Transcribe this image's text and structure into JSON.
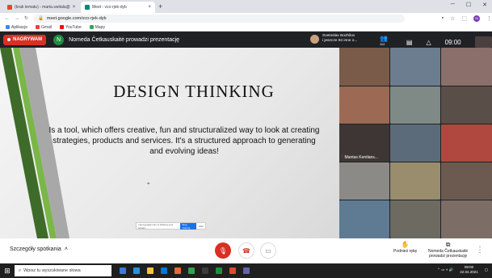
{
  "browser": {
    "tabs": [
      {
        "label": "(brak tematu) - marta.switala@",
        "active": false,
        "favicon_color": "#ea4335"
      },
      {
        "label": "Meet - vco-rjek-dyb",
        "active": true,
        "favicon_color": "#00897b"
      }
    ],
    "new_tab": "+",
    "url": "meet.google.com/vco-rjek-dyb",
    "profile_initial": "M",
    "bookmarks": [
      {
        "label": "Aplikacje",
        "color": "#4285f4"
      },
      {
        "label": "Gmail",
        "color": "#ea4335"
      },
      {
        "label": "YouTube",
        "color": "#ff0000"
      },
      {
        "label": "Mapy",
        "color": "#34a853"
      }
    ]
  },
  "meet": {
    "recording_label": "NAGRYWAM",
    "presenter_initial": "N",
    "presenter_text": "Nomeda Četkauskaitė prowadzi prezentację",
    "participants_line1": "Svetoslav Bozhilov",
    "participants_line2": "i jeszcze 94 inne o...",
    "people_count": "112",
    "clock": "09:00",
    "slide": {
      "title": "DESIGN THINKING",
      "body": "Is a tool, which offers creative, fun and structuralized way to look at creating strategies, products and services. It's a structured approach to generating and evolving ideas!"
    },
    "share_bar": {
      "text": "meet.google.com is sharing your screen.",
      "stop": "Stop sharing",
      "hide": "Hide"
    },
    "tiles": [
      {
        "bg": "#7a5b4a",
        "name": ""
      },
      {
        "bg": "#6b7d8f",
        "name": ""
      },
      {
        "bg": "#8a6f6a",
        "name": ""
      },
      {
        "bg": "#9c6a54",
        "name": ""
      },
      {
        "bg": "#7f8a86",
        "name": ""
      },
      {
        "bg": "#5a4e48",
        "name": ""
      },
      {
        "bg": "#3d3634",
        "name": "Mantas Kentlans..."
      },
      {
        "bg": "#5c6b7a",
        "name": ""
      },
      {
        "bg": "#b04840",
        "name": ""
      },
      {
        "bg": "#8b8a86",
        "name": ""
      },
      {
        "bg": "#9a8d6d",
        "name": ""
      },
      {
        "bg": "#6c5a50",
        "name": ""
      },
      {
        "bg": "#5f7b94",
        "name": ""
      },
      {
        "bg": "#6d6a62",
        "name": ""
      },
      {
        "bg": "#7c6e66",
        "name": ""
      }
    ],
    "bottom": {
      "details": "Szczegóły spotkania",
      "raise_hand": "Podnieś rękę",
      "presenting_line1": "Nomeda Četkauskaitė",
      "presenting_line2": "prowadzi prezentację"
    }
  },
  "taskbar": {
    "search_placeholder": "Wpisz tu wyszukiwane słowa",
    "time": "09:00",
    "date": "22.04.2021",
    "apps": [
      "#3c7bd9",
      "#2b90d9",
      "#f5c542",
      "#0078d7",
      "#e86b32",
      "#2da44e",
      "#3c3c3c",
      "#1e8e3e",
      "#e04a2f",
      "#6264a7"
    ]
  },
  "colors": {
    "meet_dark": "#202124",
    "record_red": "#d93025",
    "accent_green": "#7ab648",
    "accent_dark_green": "#3e6b2a"
  }
}
